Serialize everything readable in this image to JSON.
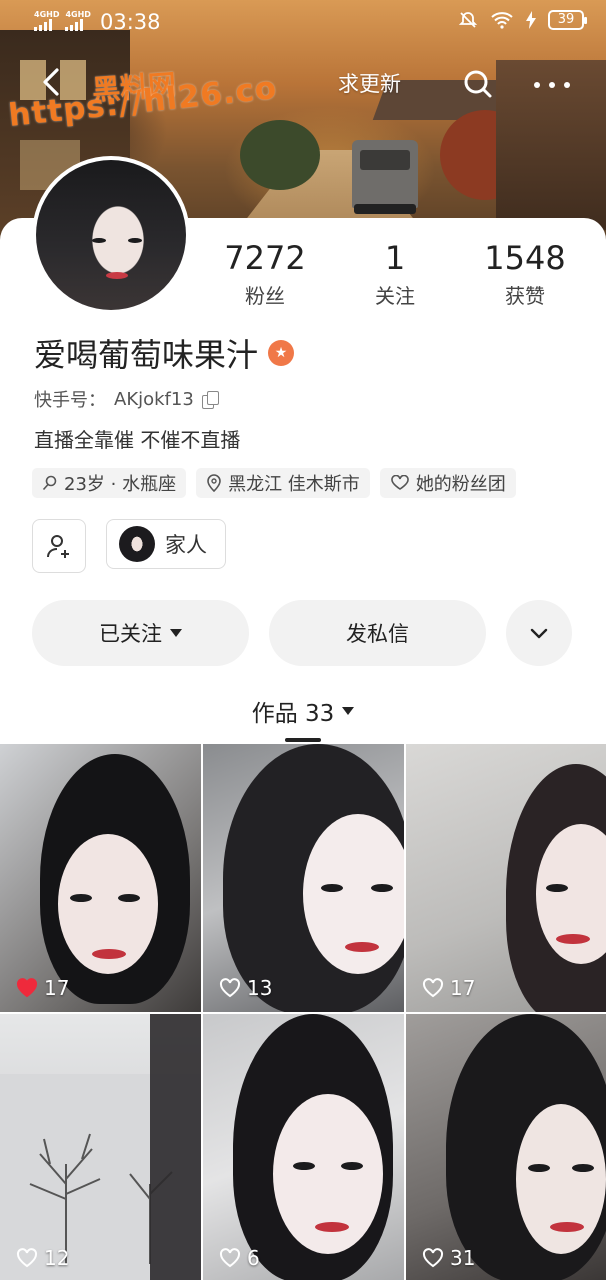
{
  "status": {
    "network1": "4GHD",
    "network2": "4GHD",
    "time": "03:38",
    "battery": "39"
  },
  "nav": {
    "request_update": "求更新"
  },
  "watermark": {
    "line1": "黑料网",
    "line2": "https://hl26.co"
  },
  "profile": {
    "name": "爱喝葡萄味果汁",
    "badge_icon": "star-badge-icon",
    "kuaishou_id_label": "快手号：",
    "kuaishou_id": "AKjokf13",
    "bio": "直播全靠催 不催不直播",
    "stats": [
      {
        "value": "7272",
        "label": "粉丝"
      },
      {
        "value": "1",
        "label": "关注"
      },
      {
        "value": "1548",
        "label": "获赞"
      }
    ],
    "tags": [
      {
        "icon": "age-icon",
        "text": "23岁 · 水瓶座"
      },
      {
        "icon": "location-pin-icon",
        "text": "黑龙江 佳木斯市"
      },
      {
        "icon": "heart-group-icon",
        "text": "她的粉丝团"
      }
    ],
    "family_label": "家人"
  },
  "actions": {
    "followed": "已关注",
    "message": "发私信"
  },
  "works": {
    "label": "作品 33"
  },
  "posts": [
    {
      "likes": "17",
      "liked": true
    },
    {
      "likes": "13",
      "liked": false
    },
    {
      "likes": "17",
      "liked": false
    },
    {
      "likes": "12",
      "liked": false
    },
    {
      "likes": "6",
      "liked": false
    },
    {
      "likes": "31",
      "liked": false
    }
  ],
  "colors": {
    "accent_badge": "#f07848",
    "liked_heart": "#ee2a3c",
    "watermark": "#f07a22"
  }
}
